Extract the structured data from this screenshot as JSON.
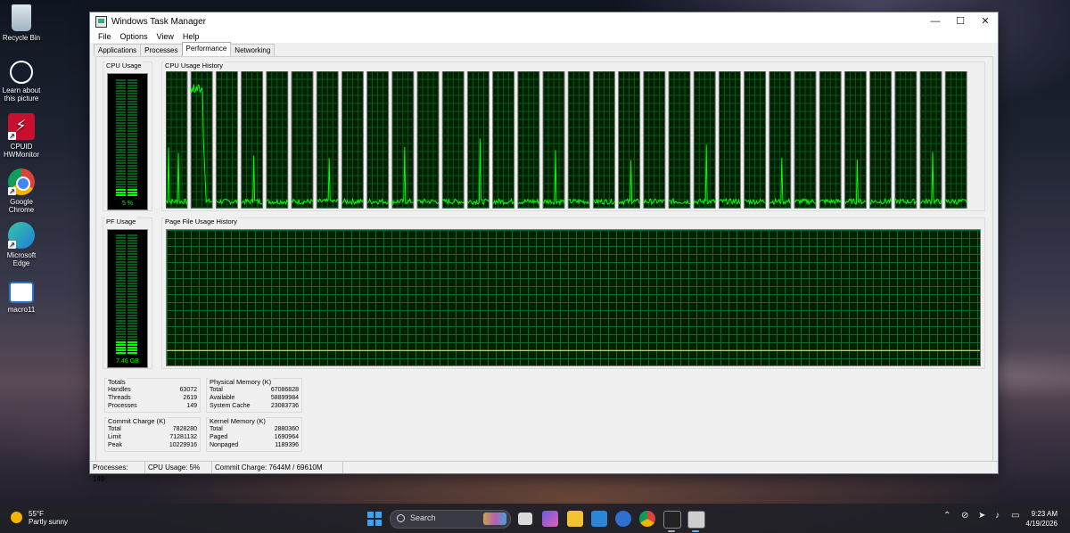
{
  "desktop": {
    "icons": [
      {
        "label": "Recycle Bin"
      },
      {
        "label": "Learn about this picture"
      },
      {
        "label": "CPUID HWMonitor"
      },
      {
        "label": "Google Chrome"
      },
      {
        "label": "Microsoft Edge"
      },
      {
        "label": "macro11"
      }
    ]
  },
  "window": {
    "title": "Windows Task Manager",
    "controls": {
      "minimize": "—",
      "maximize": "☐",
      "close": "✕"
    },
    "menu": [
      "File",
      "Options",
      "View",
      "Help"
    ],
    "tabs": [
      "Applications",
      "Processes",
      "Performance",
      "Networking"
    ],
    "active_tab": "Performance",
    "cpu_usage": {
      "label": "CPU Usage",
      "value": "5 %",
      "percent": 5
    },
    "cpu_history": {
      "label": "CPU Usage History",
      "cores": 32
    },
    "pf_usage": {
      "label": "PF Usage",
      "value": "7.46 GB",
      "fraction": 0.11
    },
    "pf_history": {
      "label": "Page File Usage History",
      "fraction": 0.11
    },
    "totals": {
      "title": "Totals",
      "rows": [
        [
          "Handles",
          "63072"
        ],
        [
          "Threads",
          "2619"
        ],
        [
          "Processes",
          "149"
        ]
      ]
    },
    "physical_memory": {
      "title": "Physical Memory (K)",
      "rows": [
        [
          "Total",
          "67086828"
        ],
        [
          "Available",
          "58899984"
        ],
        [
          "System Cache",
          "23083736"
        ]
      ]
    },
    "commit_charge": {
      "title": "Commit Charge (K)",
      "rows": [
        [
          "Total",
          "7828280"
        ],
        [
          "Limit",
          "71281132"
        ],
        [
          "Peak",
          "10229916"
        ]
      ]
    },
    "kernel_memory": {
      "title": "Kernel Memory (K)",
      "rows": [
        [
          "Total",
          "2880360"
        ],
        [
          "Paged",
          "1690964"
        ],
        [
          "Nonpaged",
          "1189396"
        ]
      ]
    },
    "status": {
      "processes": "Processes: 149",
      "cpu": "CPU Usage: 5%",
      "commit": "Commit Charge: 7644M / 69610M"
    }
  },
  "taskbar": {
    "weather_temp": "55°F",
    "weather_desc": "Partly sunny",
    "search_label": "Search",
    "time": "9:23 AM",
    "date": "4/19/2026"
  },
  "colors": {
    "graph_line": "#00ff00",
    "graph_bg": "#002000",
    "grid": "#0a6a2a",
    "pf_line": "#ffff00"
  }
}
